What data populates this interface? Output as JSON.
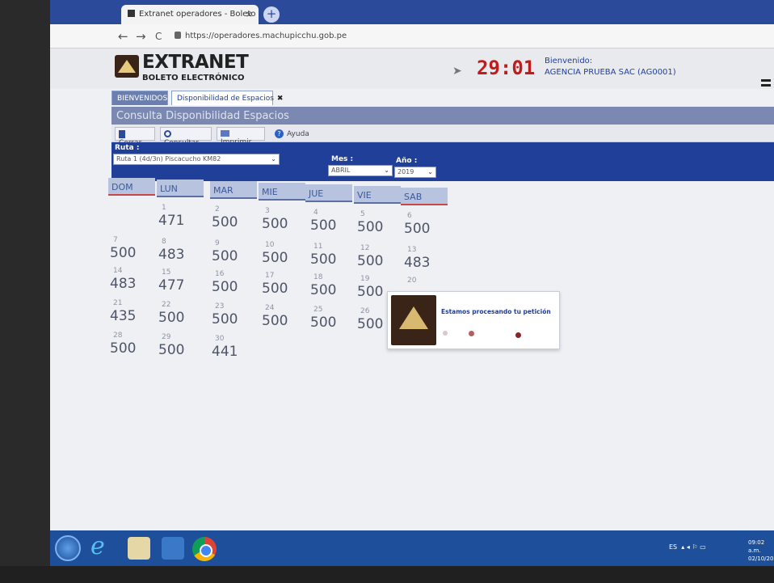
{
  "browser": {
    "tab_title": "Extranet operadores - Boleto Ele",
    "tab_close": "×",
    "new_tab": "+",
    "back": "←",
    "forward": "→",
    "reload": "C",
    "url": "https://operadores.machupicchu.gob.pe"
  },
  "header": {
    "brand_title": "EXTRANET",
    "brand_subtitle": "BOLETO ELECTRÓNICO",
    "timer": "29:01",
    "welcome_label": "Bienvenido:",
    "welcome_name": "AGENCIA PRUEBA SAC (AG0001)"
  },
  "app_tabs": [
    {
      "label": "BIENVENIDOS"
    },
    {
      "label": "Disponibilidad de Espacios",
      "close": "✖"
    }
  ],
  "panel": {
    "title": "Consulta Disponibilidad Espacios",
    "actions": {
      "cerrar": "Cerrar",
      "consultar": "Consultar",
      "imprimir": "Imprimir",
      "ayuda": "Ayuda"
    }
  },
  "filters": {
    "ruta_label": "Ruta :",
    "ruta_value": "Ruta 1 (4d/3n) Piscacucho KM82",
    "mes_label": "Mes :",
    "mes_value": "ABRIL",
    "anio_label": "Año :",
    "anio_value": "2019",
    "caret": "⌄"
  },
  "calendar": {
    "days": [
      "DOM",
      "LUN",
      "MAR",
      "MIE",
      "JUE",
      "VIE",
      "SAB"
    ],
    "rows": [
      [
        null,
        {
          "d": "1",
          "v": "471"
        },
        {
          "d": "2",
          "v": "500"
        },
        {
          "d": "3",
          "v": "500"
        },
        {
          "d": "4",
          "v": "500"
        },
        {
          "d": "5",
          "v": "500"
        },
        {
          "d": "6",
          "v": "500"
        }
      ],
      [
        {
          "d": "7",
          "v": "500"
        },
        {
          "d": "8",
          "v": "483"
        },
        {
          "d": "9",
          "v": "500"
        },
        {
          "d": "10",
          "v": "500"
        },
        {
          "d": "11",
          "v": "500"
        },
        {
          "d": "12",
          "v": "500"
        },
        {
          "d": "13",
          "v": "483"
        }
      ],
      [
        {
          "d": "14",
          "v": "483"
        },
        {
          "d": "15",
          "v": "477"
        },
        {
          "d": "16",
          "v": "500"
        },
        {
          "d": "17",
          "v": "500"
        },
        {
          "d": "18",
          "v": "500"
        },
        {
          "d": "19",
          "v": "500"
        },
        {
          "d": "20",
          "v": ""
        }
      ],
      [
        {
          "d": "21",
          "v": "435"
        },
        {
          "d": "22",
          "v": "500"
        },
        {
          "d": "23",
          "v": "500"
        },
        {
          "d": "24",
          "v": "500"
        },
        {
          "d": "25",
          "v": "500"
        },
        {
          "d": "26",
          "v": "500"
        },
        null
      ],
      [
        {
          "d": "28",
          "v": "500"
        },
        {
          "d": "29",
          "v": "500"
        },
        {
          "d": "30",
          "v": "441"
        },
        null,
        null,
        null,
        null
      ]
    ]
  },
  "dialog": {
    "message": "Estamos procesando tu petición"
  },
  "taskbar": {
    "tray_lang": "ES",
    "tray_icons": "▴ ◂ ⚐ ▭",
    "clock_time": "09:02 a.m.",
    "clock_date": "02/10/201"
  }
}
